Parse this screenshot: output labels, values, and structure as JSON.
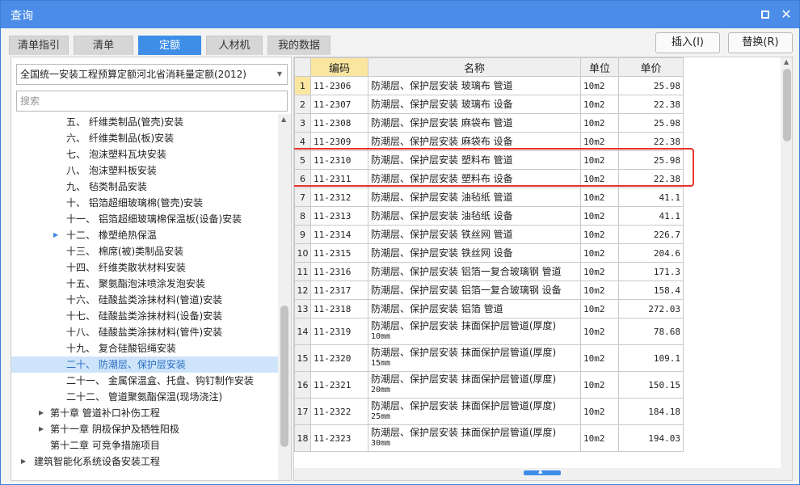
{
  "window": {
    "title": "查询",
    "maximize_label": "",
    "close_label": "✕"
  },
  "tabs": [
    "清单指引",
    "清单",
    "定额",
    "人材机",
    "我的数据"
  ],
  "buttons": {
    "insert": "插入(I)",
    "replace": "替换(R)"
  },
  "left": {
    "quota_select": "全国统一安装工程预算定额河北省消耗量定额(2012)",
    "search_placeholder": "搜索",
    "tree": [
      "五、 纤维类制品(管壳)安装",
      "六、 纤维类制品(板)安装",
      "七、 泡沫塑料瓦块安装",
      "八、 泡沫塑料板安装",
      "九、 毡类制品安装",
      "十、 铝箔超细玻璃棉(管壳)安装",
      "十一、 铝箔超细玻璃棉保温板(设备)安装",
      "十二、 橡塑绝热保温",
      "十三、 棉席(被)类制品安装",
      "十四、 纤维类散状材料安装",
      "十五、 聚氨酯泡沫喷涂发泡安装",
      "十六、 硅酸盐类涂抹材料(管道)安装",
      "十七、 硅酸盐类涂抹材料(设备)安装",
      "十八、 硅酸盐类涂抹材料(管件)安装",
      "十九、 复合硅酸铝绳安装",
      "二十、 防潮层、保护层安装",
      "二十一、 金属保温盒、托盘、钩钉制作安装",
      "二十二、 管道聚氨酯保温(现场浇注)",
      "第十章 管道补口补伤工程",
      "第十一章 阴极保护及牺牲阳极",
      "第十二章 可竞争措施项目",
      "建筑智能化系统设备安装工程"
    ]
  },
  "grid": {
    "headers": {
      "code": "编码",
      "name": "名称",
      "unit": "单位",
      "price": "单价"
    },
    "rows": [
      {
        "n": "1",
        "code": "11-2306",
        "name": "防潮层、保护层安装 玻璃布 管道",
        "sub": "",
        "unit": "10m2",
        "price": "25.98"
      },
      {
        "n": "2",
        "code": "11-2307",
        "name": "防潮层、保护层安装 玻璃布 设备",
        "sub": "",
        "unit": "10m2",
        "price": "22.38"
      },
      {
        "n": "3",
        "code": "11-2308",
        "name": "防潮层、保护层安装 麻袋布 管道",
        "sub": "",
        "unit": "10m2",
        "price": "25.98"
      },
      {
        "n": "4",
        "code": "11-2309",
        "name": "防潮层、保护层安装 麻袋布 设备",
        "sub": "",
        "unit": "10m2",
        "price": "22.38"
      },
      {
        "n": "5",
        "code": "11-2310",
        "name": "防潮层、保护层安装 塑料布 管道",
        "sub": "",
        "unit": "10m2",
        "price": "25.98"
      },
      {
        "n": "6",
        "code": "11-2311",
        "name": "防潮层、保护层安装 塑料布 设备",
        "sub": "",
        "unit": "10m2",
        "price": "22.38"
      },
      {
        "n": "7",
        "code": "11-2312",
        "name": "防潮层、保护层安装 油毡纸 管道",
        "sub": "",
        "unit": "10m2",
        "price": "41.1"
      },
      {
        "n": "8",
        "code": "11-2313",
        "name": "防潮层、保护层安装 油毡纸 设备",
        "sub": "",
        "unit": "10m2",
        "price": "41.1"
      },
      {
        "n": "9",
        "code": "11-2314",
        "name": "防潮层、保护层安装 铁丝网 管道",
        "sub": "",
        "unit": "10m2",
        "price": "226.7"
      },
      {
        "n": "10",
        "code": "11-2315",
        "name": "防潮层、保护层安装 铁丝网 设备",
        "sub": "",
        "unit": "10m2",
        "price": "204.6"
      },
      {
        "n": "11",
        "code": "11-2316",
        "name": "防潮层、保护层安装 铝箔一复合玻璃钢 管道",
        "sub": "",
        "unit": "10m2",
        "price": "171.3"
      },
      {
        "n": "12",
        "code": "11-2317",
        "name": "防潮层、保护层安装 铝箔一复合玻璃钢 设备",
        "sub": "",
        "unit": "10m2",
        "price": "158.4"
      },
      {
        "n": "13",
        "code": "11-2318",
        "name": "防潮层、保护层安装 铝箔 管道",
        "sub": "",
        "unit": "10m2",
        "price": "272.03"
      },
      {
        "n": "14",
        "code": "11-2319",
        "name": "防潮层、保护层安装 抹面保护层管道(厚度)",
        "sub": "10mm",
        "unit": "10m2",
        "price": "78.68"
      },
      {
        "n": "15",
        "code": "11-2320",
        "name": "防潮层、保护层安装 抹面保护层管道(厚度)",
        "sub": "15mm",
        "unit": "10m2",
        "price": "109.1"
      },
      {
        "n": "16",
        "code": "11-2321",
        "name": "防潮层、保护层安装 抹面保护层管道(厚度)",
        "sub": "20mm",
        "unit": "10m2",
        "price": "150.15"
      },
      {
        "n": "17",
        "code": "11-2322",
        "name": "防潮层、保护层安装 抹面保护层管道(厚度)",
        "sub": "25mm",
        "unit": "10m2",
        "price": "184.18"
      },
      {
        "n": "18",
        "code": "11-2323",
        "name": "防潮层、保护层安装 抹面保护层管道(厚度)",
        "sub": "30mm",
        "unit": "10m2",
        "price": "194.03"
      }
    ]
  }
}
